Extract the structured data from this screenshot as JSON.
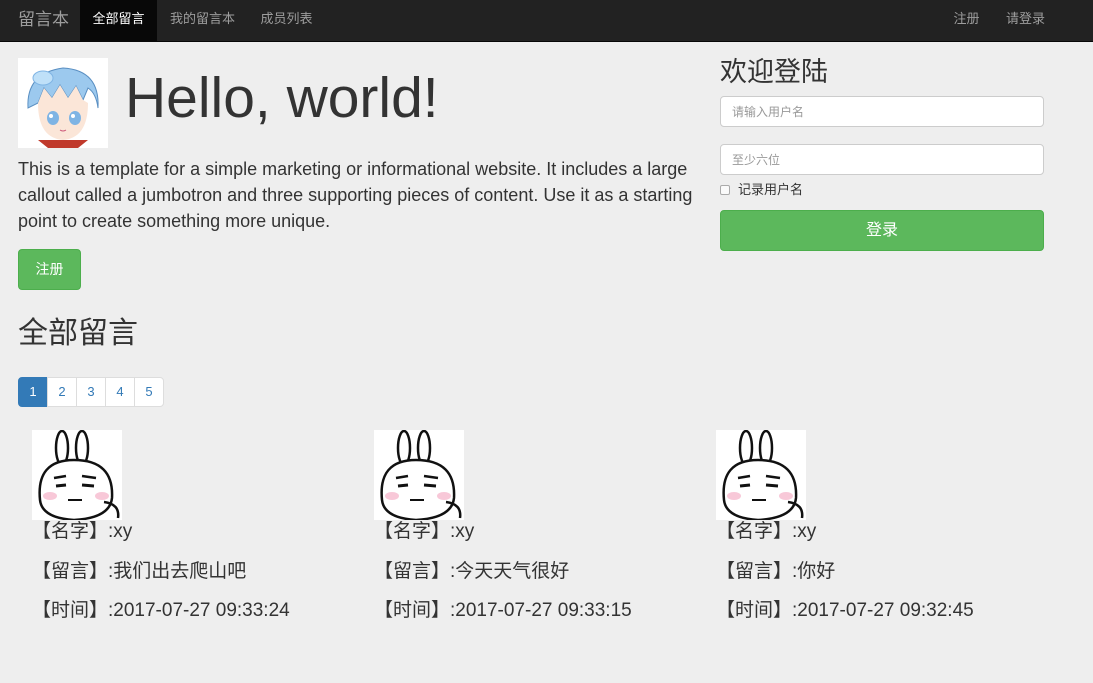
{
  "navbar": {
    "brand": "留言本",
    "links": [
      {
        "label": "全部留言",
        "active": true
      },
      {
        "label": "我的留言本",
        "active": false
      },
      {
        "label": "成员列表",
        "active": false
      }
    ],
    "right_links": [
      {
        "label": "注册"
      },
      {
        "label": "请登录"
      }
    ]
  },
  "jumbotron": {
    "title": "Hello, world!",
    "lead": "This is a template for a simple marketing or informational website. It includes a large callout called a jumbotron and three supporting pieces of content. Use it as a starting point to create something more unique.",
    "register_button": "注册"
  },
  "login": {
    "title": "欢迎登陆",
    "username_placeholder": "请输入用户名",
    "password_placeholder": "至少六位",
    "remember_label": "记录用户名",
    "remember_checked": false,
    "submit_button": "登录"
  },
  "messages": {
    "title": "全部留言",
    "pages": [
      "1",
      "2",
      "3",
      "4",
      "5"
    ],
    "current_page": "1",
    "items": [
      {
        "name": "【名字】:xy",
        "content": "【留言】:我们出去爬山吧",
        "time": "【时间】:2017-07-27 09:33:24"
      },
      {
        "name": "【名字】:xy",
        "content": "【留言】:今天天气很好",
        "time": "【时间】:2017-07-27 09:33:15"
      },
      {
        "name": "【名字】:xy",
        "content": "【留言】:你好",
        "time": "【时间】:2017-07-27 09:32:45"
      }
    ]
  },
  "colors": {
    "navbar_bg": "#222222",
    "success": "#5cb85c",
    "primary": "#337ab7",
    "page_bg": "#eeeeee"
  }
}
